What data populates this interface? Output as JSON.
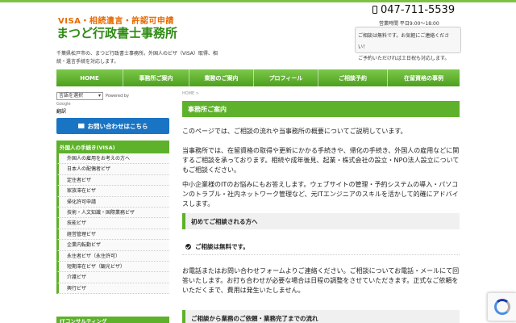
{
  "header": {
    "logo_sub": "VISA・相続遺言・許認可申請",
    "logo_main": "まつど行政書士事務所",
    "tagline": "千葉県松戸市の、まつど行政書士事務所。外国人のビザ（VISA）取得、相続・遺言手続を対応します。",
    "phone": "047-711-5539",
    "hours": "営業時間 平日9:00～18:00",
    "contact_line1": "ご相談は無料です。お気軽にご連絡ください！",
    "contact_line2": "ご予約いただければ土日祝も対応します。"
  },
  "nav": {
    "items": [
      "HOME",
      "事務所ご案内",
      "業務のご案内",
      "プロフィール",
      "ご相談予約",
      "在留資格の事例"
    ]
  },
  "sidebar": {
    "lang_select_value": "言語を選択",
    "powered_by": "Powered by",
    "google": "Google",
    "translate": "翻訳",
    "inquiry_button": "お問い合わせはこちら",
    "visa_header": "外国人の手続き(VISA)",
    "visa_items": [
      "外国人の雇用をお考えの方へ",
      "日本人の配偶者ビザ",
      "定住者ビザ",
      "家族滞在ビザ",
      "帰化許可申請",
      "技術・人文知識・国際業務ビザ",
      "技能ビザ",
      "経営管理ビザ",
      "企業内転勤ビザ",
      "永住者ビザ（永住許可）",
      "短期滞在ビザ（観光ビザ）",
      "介護ビザ",
      "興行ビザ"
    ],
    "it_header": "ITコンサルティング"
  },
  "main": {
    "breadcrumb": "HOME >",
    "title": "事務所ご案内",
    "para1": "このページでは、ご相談の流れや当事務所の概要についてご説明しています。",
    "para2": "当事務所では、在留資格の取得や更新にかかる手続きや、帰化の手続き、外国人の雇用などに関するご相談を承っております。相続や成年後見、起業・株式会社の設立・NPO法人設立についてもご相談ください。",
    "para3": "中小企業様のITのお悩みにもお答えします。ウェブサイトの管理・予約システムの導入・パソコンのトラブル・社内ネットワーク管理など、元ITエンジニアのスキルを活かして的確にアドバイスします。",
    "section_first": "初めてご相談される方へ",
    "free_label": "ご相談は無料です。",
    "para4": "お電話またはお問い合わせフォームよりご連絡ください。ご相談についてお電話・メールにて回答いたします。お打ち合わせが必要な場合は日程の調整をさせていただきます。正式なご依頼をいただくまで、費用は発生いたしません。",
    "section_flow": "ご相談から業務のご依頼・業務完了までの流れ"
  },
  "colors": {
    "brand_green": "#5eb12a",
    "accent_orange": "#e86a00",
    "button_blue": "#1a74c4"
  }
}
